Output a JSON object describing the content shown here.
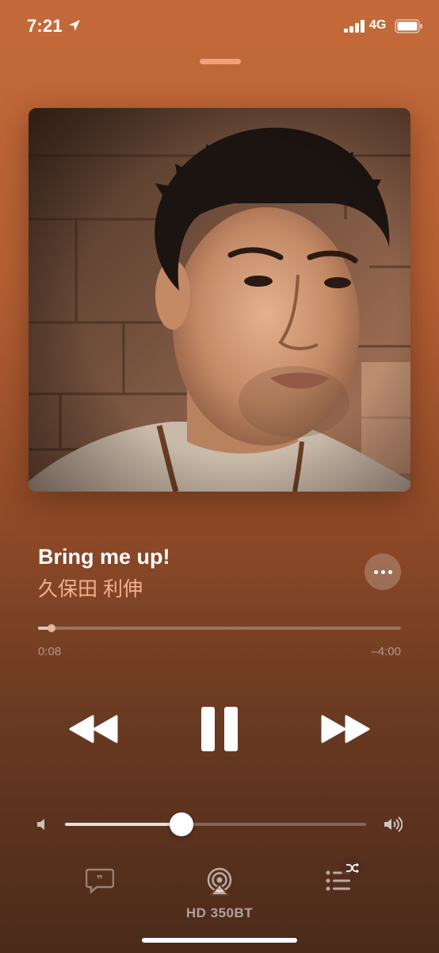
{
  "status_bar": {
    "time": "7:21",
    "network": "4G"
  },
  "now_playing": {
    "title": "Bring me up!",
    "artist": "久保田 利伸",
    "elapsed": "0:08",
    "remaining": "–4:00",
    "progress_fraction": 0.035,
    "volume_fraction": 0.39
  },
  "controls": {
    "rewind_icon": "rewind-icon",
    "pause_icon": "pause-icon",
    "forward_icon": "fast-forward-icon",
    "more_icon": "ellipsis-icon"
  },
  "bottom_bar": {
    "airplay_device": "HD 350BT",
    "lyrics_icon": "lyrics-icon",
    "airplay_icon": "airplay-icon",
    "queue_icon": "queue-icon",
    "shuffle_icon": "shuffle-icon"
  },
  "colors": {
    "background_top": "#c46a3a",
    "background_bottom": "#4b2a1a",
    "artist_text": "#f4b08c",
    "grabber": "#f2a07a"
  }
}
